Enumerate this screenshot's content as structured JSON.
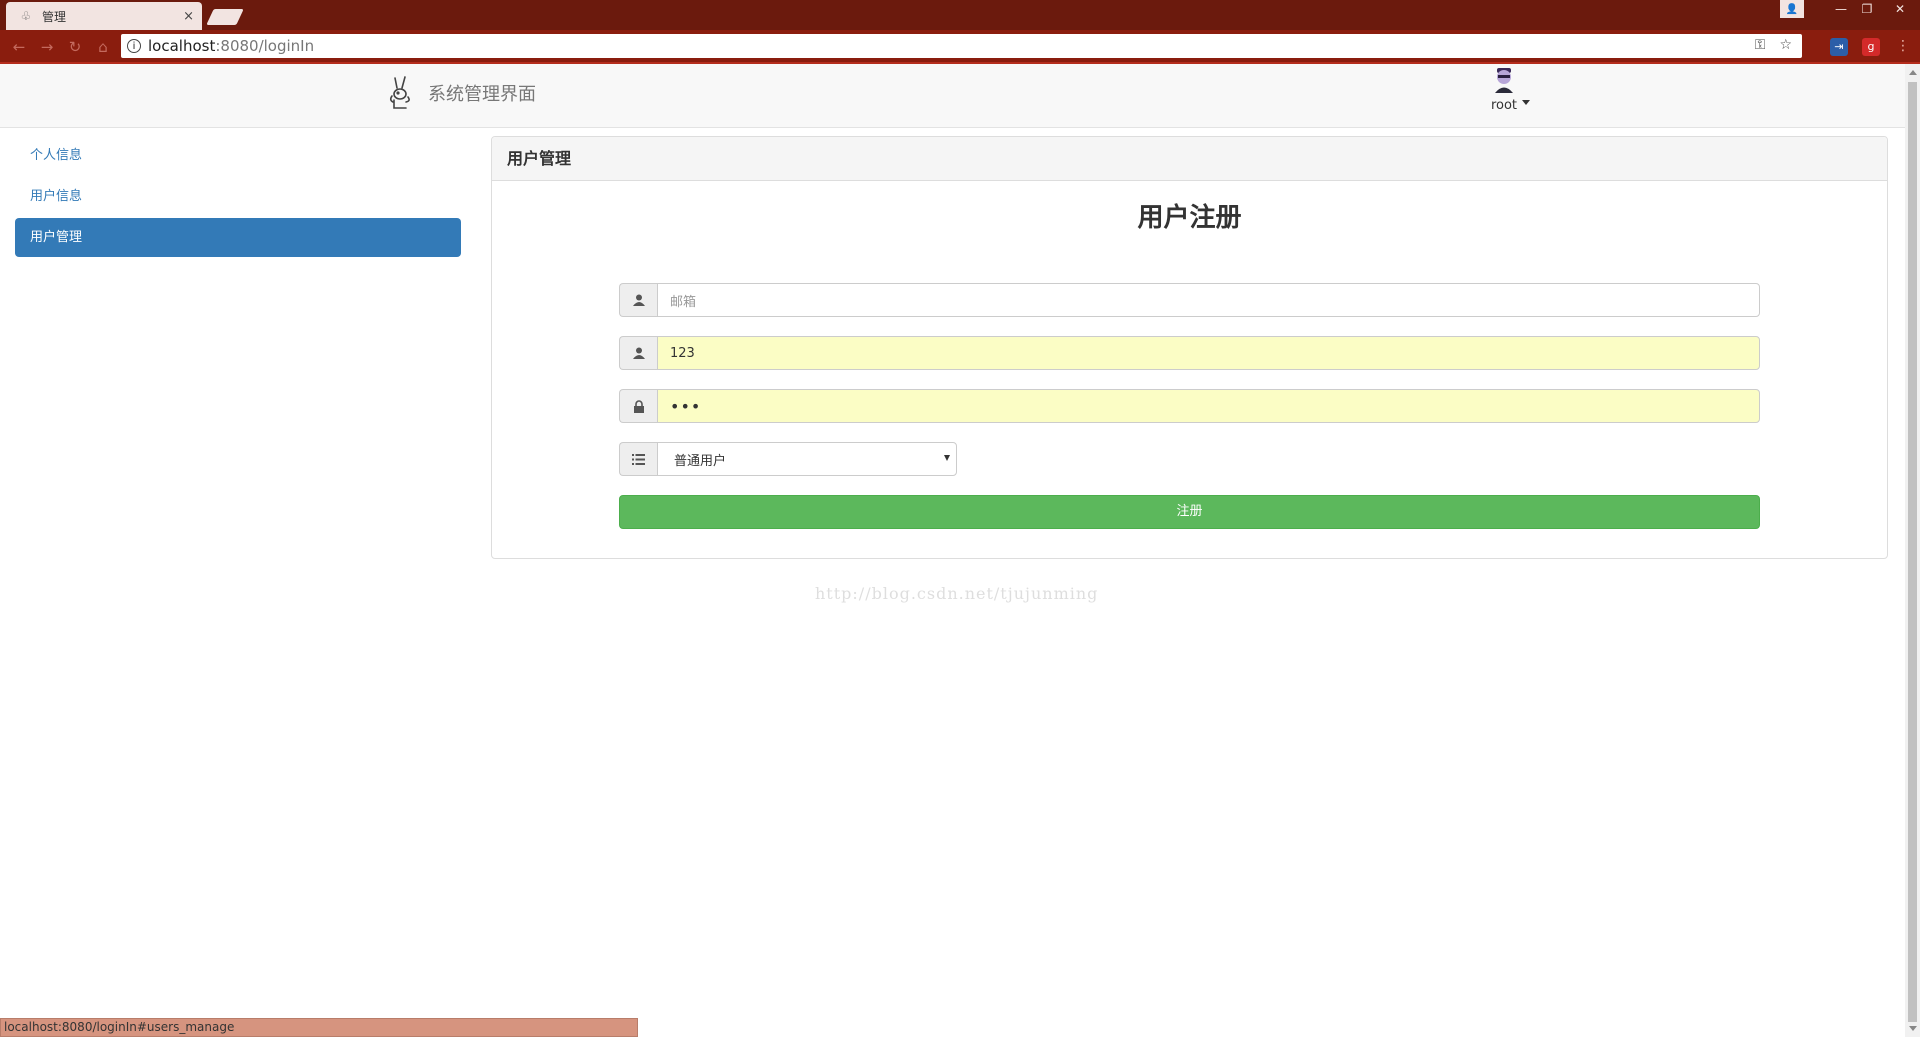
{
  "browser": {
    "tab_title": "管理",
    "tab_close": "×",
    "url_host": "localhost",
    "url_path": ":8080/loginIn",
    "window_controls": [
      "minimize-icon",
      "restore-icon",
      "close-icon"
    ]
  },
  "navbar": {
    "brand": "系统管理界面",
    "username": "root"
  },
  "sidebar": {
    "items": [
      {
        "label": "个人信息",
        "active": false
      },
      {
        "label": "用户信息",
        "active": false
      },
      {
        "label": "用户管理",
        "active": true
      }
    ]
  },
  "panel": {
    "heading": "用户管理",
    "form_title": "用户注册",
    "email": {
      "placeholder": "邮箱",
      "value": ""
    },
    "username": {
      "value": "123"
    },
    "password": {
      "masked": "•••"
    },
    "role": {
      "selected": "普通用户"
    },
    "submit_label": "注册"
  },
  "watermark": "http://blog.csdn.net/tjujunming",
  "status_bar": "localhost:8080/loginIn#users_manage",
  "colors": {
    "primary": "#337ab7",
    "success": "#5cb85c",
    "autofill": "#fbfdc5",
    "chrome": "#8a1d0e"
  }
}
